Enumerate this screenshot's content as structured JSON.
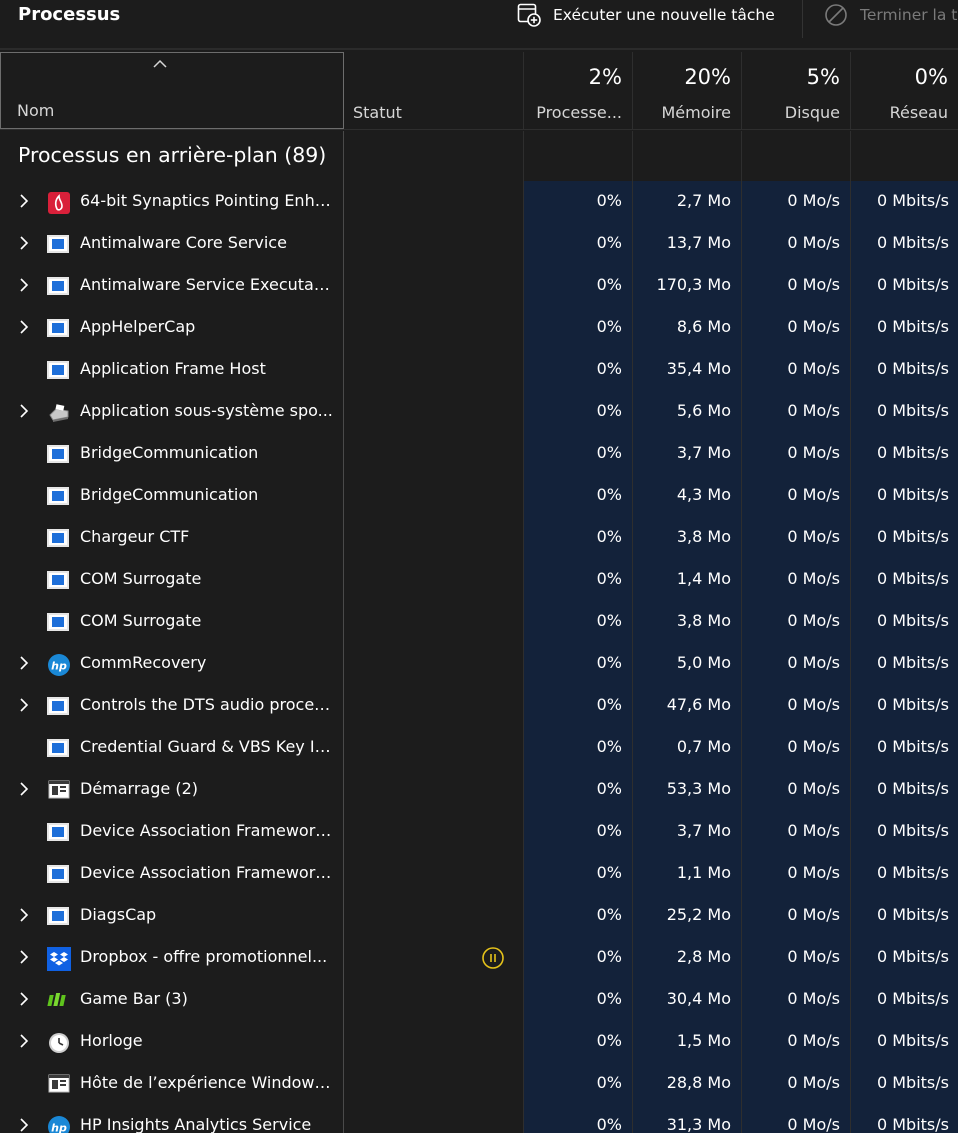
{
  "topbar": {
    "title": "Processus",
    "run_task_label": "Exécuter une nouvelle tâche",
    "end_task_label": "Terminer la t"
  },
  "columns": {
    "name": "Nom",
    "status": "Statut",
    "cpu": {
      "pct": "2%",
      "label": "Processe..."
    },
    "memory": {
      "pct": "20%",
      "label": "Mémoire"
    },
    "disk": {
      "pct": "5%",
      "label": "Disque"
    },
    "network": {
      "pct": "0%",
      "label": "Réseau"
    }
  },
  "group": {
    "title": "Processus en arrière-plan (89)"
  },
  "colors": {
    "background": "#1c1c1c",
    "tint": "#13223a",
    "paused": "#e5c21a"
  },
  "rows": [
    {
      "name": "64-bit Synaptics Pointing Enha...",
      "icon": "synaptics-icon",
      "expandable": true,
      "paused": false,
      "cpu": "0%",
      "mem": "2,7 Mo",
      "disk": "0 Mo/s",
      "net": "0 Mbits/s"
    },
    {
      "name": "Antimalware Core Service",
      "icon": "window-app-icon",
      "expandable": true,
      "paused": false,
      "cpu": "0%",
      "mem": "13,7 Mo",
      "disk": "0 Mo/s",
      "net": "0 Mbits/s"
    },
    {
      "name": "Antimalware Service Executable",
      "icon": "window-app-icon",
      "expandable": true,
      "paused": false,
      "cpu": "0%",
      "mem": "170,3 Mo",
      "disk": "0 Mo/s",
      "net": "0 Mbits/s"
    },
    {
      "name": "AppHelperCap",
      "icon": "window-app-icon",
      "expandable": true,
      "paused": false,
      "cpu": "0%",
      "mem": "8,6 Mo",
      "disk": "0 Mo/s",
      "net": "0 Mbits/s"
    },
    {
      "name": "Application Frame Host",
      "icon": "window-app-icon",
      "expandable": false,
      "paused": false,
      "cpu": "0%",
      "mem": "35,4 Mo",
      "disk": "0 Mo/s",
      "net": "0 Mbits/s"
    },
    {
      "name": "Application sous-système spo...",
      "icon": "printer-icon",
      "expandable": true,
      "paused": false,
      "cpu": "0%",
      "mem": "5,6 Mo",
      "disk": "0 Mo/s",
      "net": "0 Mbits/s"
    },
    {
      "name": "BridgeCommunication",
      "icon": "window-app-icon",
      "expandable": false,
      "paused": false,
      "cpu": "0%",
      "mem": "3,7 Mo",
      "disk": "0 Mo/s",
      "net": "0 Mbits/s"
    },
    {
      "name": "BridgeCommunication",
      "icon": "window-app-icon",
      "expandable": false,
      "paused": false,
      "cpu": "0%",
      "mem": "4,3 Mo",
      "disk": "0 Mo/s",
      "net": "0 Mbits/s"
    },
    {
      "name": "Chargeur CTF",
      "icon": "window-app-icon",
      "expandable": false,
      "paused": false,
      "cpu": "0%",
      "mem": "3,8 Mo",
      "disk": "0 Mo/s",
      "net": "0 Mbits/s"
    },
    {
      "name": "COM Surrogate",
      "icon": "window-app-icon",
      "expandable": false,
      "paused": false,
      "cpu": "0%",
      "mem": "1,4 Mo",
      "disk": "0 Mo/s",
      "net": "0 Mbits/s"
    },
    {
      "name": "COM Surrogate",
      "icon": "window-app-icon",
      "expandable": false,
      "paused": false,
      "cpu": "0%",
      "mem": "3,8 Mo",
      "disk": "0 Mo/s",
      "net": "0 Mbits/s"
    },
    {
      "name": "CommRecovery",
      "icon": "hp-logo-icon",
      "expandable": true,
      "paused": false,
      "cpu": "0%",
      "mem": "5,0 Mo",
      "disk": "0 Mo/s",
      "net": "0 Mbits/s"
    },
    {
      "name": "Controls the DTS audio proces...",
      "icon": "window-app-icon",
      "expandable": true,
      "paused": false,
      "cpu": "0%",
      "mem": "47,6 Mo",
      "disk": "0 Mo/s",
      "net": "0 Mbits/s"
    },
    {
      "name": "Credential Guard & VBS Key Is...",
      "icon": "window-app-icon",
      "expandable": false,
      "paused": false,
      "cpu": "0%",
      "mem": "0,7 Mo",
      "disk": "0 Mo/s",
      "net": "0 Mbits/s"
    },
    {
      "name": "Démarrage (2)",
      "icon": "startup-icon",
      "expandable": true,
      "paused": false,
      "cpu": "0%",
      "mem": "53,3 Mo",
      "disk": "0 Mo/s",
      "net": "0 Mbits/s"
    },
    {
      "name": "Device Association Framework...",
      "icon": "window-app-icon",
      "expandable": false,
      "paused": false,
      "cpu": "0%",
      "mem": "3,7 Mo",
      "disk": "0 Mo/s",
      "net": "0 Mbits/s"
    },
    {
      "name": "Device Association Framework...",
      "icon": "window-app-icon",
      "expandable": false,
      "paused": false,
      "cpu": "0%",
      "mem": "1,1 Mo",
      "disk": "0 Mo/s",
      "net": "0 Mbits/s"
    },
    {
      "name": "DiagsCap",
      "icon": "window-app-icon",
      "expandable": true,
      "paused": false,
      "cpu": "0%",
      "mem": "25,2 Mo",
      "disk": "0 Mo/s",
      "net": "0 Mbits/s"
    },
    {
      "name": "Dropbox - offre promotionnel...",
      "icon": "dropbox-icon",
      "expandable": true,
      "paused": true,
      "cpu": "0%",
      "mem": "2,8 Mo",
      "disk": "0 Mo/s",
      "net": "0 Mbits/s"
    },
    {
      "name": "Game Bar (3)",
      "icon": "game-bar-icon",
      "expandable": true,
      "paused": false,
      "cpu": "0%",
      "mem": "30,4 Mo",
      "disk": "0 Mo/s",
      "net": "0 Mbits/s"
    },
    {
      "name": "Horloge",
      "icon": "clock-icon",
      "expandable": true,
      "paused": false,
      "cpu": "0%",
      "mem": "1,5 Mo",
      "disk": "0 Mo/s",
      "net": "0 Mbits/s"
    },
    {
      "name": "Hôte de l’expérience Windows...",
      "icon": "startup-icon",
      "expandable": false,
      "paused": false,
      "cpu": "0%",
      "mem": "28,8 Mo",
      "disk": "0 Mo/s",
      "net": "0 Mbits/s"
    },
    {
      "name": "HP Insights Analytics Service",
      "icon": "hp-logo-icon",
      "expandable": true,
      "paused": false,
      "cpu": "0%",
      "mem": "31,3 Mo",
      "disk": "0 Mo/s",
      "net": "0 Mbits/s"
    }
  ]
}
